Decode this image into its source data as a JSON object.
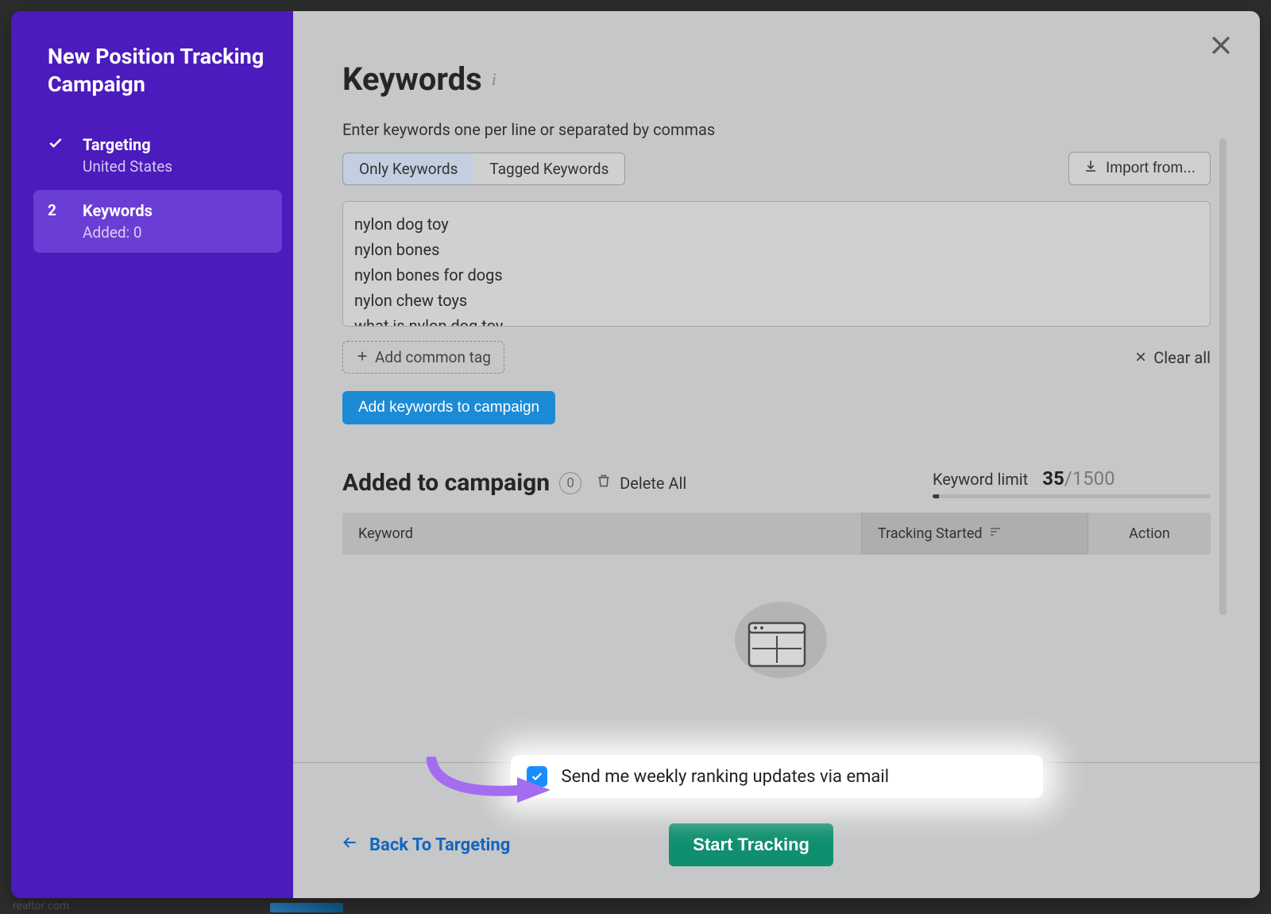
{
  "sidebar": {
    "title": "New Position Tracking Campaign",
    "steps": [
      {
        "label": "Targeting",
        "sub": "United States",
        "done": true
      },
      {
        "num": "2",
        "label": "Keywords",
        "sub": "Added: 0",
        "active": true
      }
    ]
  },
  "header": {
    "title": "Keywords",
    "instructions": "Enter keywords one per line or separated by commas",
    "tabs": {
      "only": "Only Keywords",
      "tagged": "Tagged Keywords"
    },
    "import": "Import from..."
  },
  "keywords_value": "nylon dog toy\nnylon bones\nnylon bones for dogs\nnylon chew toys\nwhat is nylon dog toy",
  "below": {
    "add_tag": "Add common tag",
    "clear_all": "Clear all",
    "add_to_campaign": "Add keywords to campaign"
  },
  "campaign": {
    "title": "Added to campaign",
    "count": "0",
    "delete_all": "Delete All",
    "limit_label": "Keyword limit",
    "limit_used": "35",
    "limit_sep": "/",
    "limit_total": "1500",
    "limit_pct": 2.3,
    "columns": {
      "keyword": "Keyword",
      "tracking": "Tracking Started",
      "action": "Action"
    }
  },
  "footer": {
    "email_label": "Send me weekly ranking updates via email",
    "email_checked": true,
    "back": "Back To Targeting",
    "start": "Start Tracking"
  },
  "colors": {
    "sidebar_bg": "#4b1bbd",
    "sidebar_active": "#6a3dd4",
    "primary_blue": "#1d8ad6",
    "green": "#0f8f6f",
    "arrow": "#a46cf0"
  },
  "bg_peek": "realtor com"
}
